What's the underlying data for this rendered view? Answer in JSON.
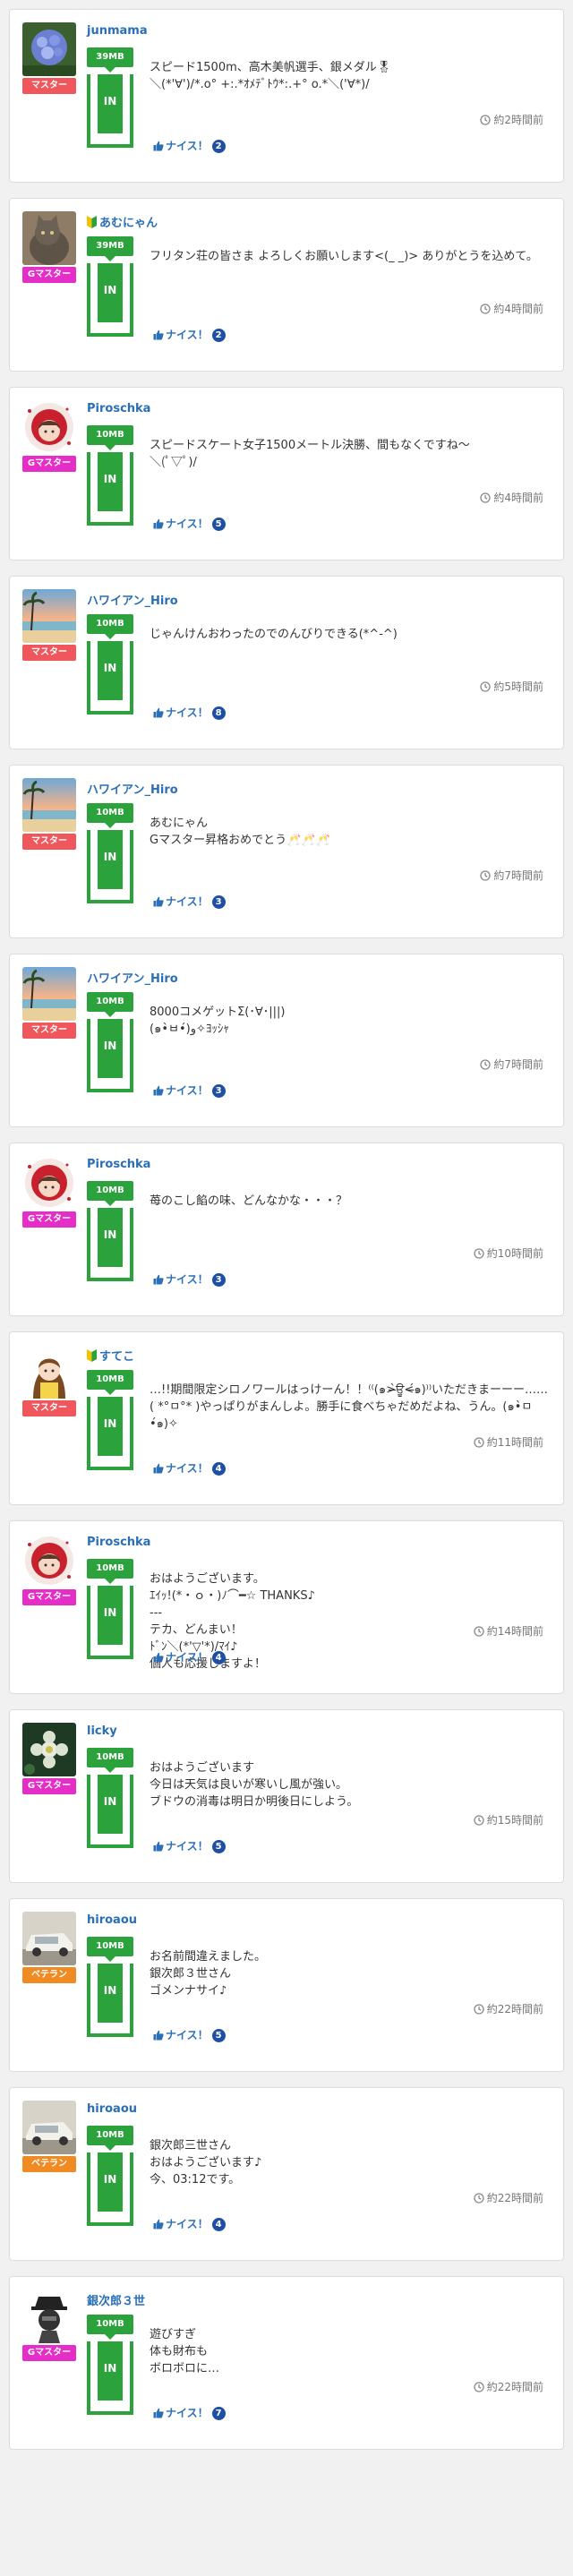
{
  "colors": {
    "rank_master": "#f0575c",
    "rank_g_master": "#e52dc7",
    "rank_veteran": "#f08b24",
    "data_green": "#2ba23b",
    "link_blue": "#2a6fb7"
  },
  "feed": [
    {
      "username": "junmama",
      "beginner_mark": false,
      "avatar": "hydrangea-photo",
      "rank": "マスター",
      "rank_type": "master",
      "data_amount": "39MB",
      "in_label": "IN",
      "message": "スピード1500m、高木美帆選手、銀メダル🎖\n＼(*'∀')/*.o° +:.*ｵﾒﾃﾞﾄｳ*:.+° o.*＼('∀*)/",
      "time": "約2時間前",
      "nice_label": "ナイス！",
      "nice_count": "2"
    },
    {
      "username": "あむにゃん",
      "beginner_mark": true,
      "avatar": "cat-photo",
      "rank": "Gマスター",
      "rank_type": "g_master",
      "data_amount": "39MB",
      "in_label": "IN",
      "message": "フリタン荘の皆さま よろしくお願いします<(_ _)> ありがとうを込めて。",
      "time": "約4時間前",
      "nice_label": "ナイス！",
      "nice_count": "2"
    },
    {
      "username": "Piroschka",
      "beginner_mark": false,
      "avatar": "red-hood-girl-illustration",
      "rank": "Gマスター",
      "rank_type": "g_master",
      "data_amount": "10MB",
      "in_label": "IN",
      "message": "スピードスケート女子1500メートル決勝、間もなくですね～\n＼(ﾟ▽ﾟ)/",
      "time": "約4時間前",
      "nice_label": "ナイス！",
      "nice_count": "5"
    },
    {
      "username": "ハワイアン_Hiro",
      "beginner_mark": false,
      "avatar": "sunset-beach-photo",
      "rank": "マスター",
      "rank_type": "master",
      "data_amount": "10MB",
      "in_label": "IN",
      "message": "じゃんけんおわったのでのんびりできる(*^-^)",
      "time": "約5時間前",
      "nice_label": "ナイス！",
      "nice_count": "8"
    },
    {
      "username": "ハワイアン_Hiro",
      "beginner_mark": false,
      "avatar": "sunset-beach-photo",
      "rank": "マスター",
      "rank_type": "master",
      "data_amount": "10MB",
      "in_label": "IN",
      "message": "あむにゃん\nGマスター昇格おめでとう🥂🥂🥂",
      "time": "約7時間前",
      "nice_label": "ナイス！",
      "nice_count": "3"
    },
    {
      "username": "ハワイアン_Hiro",
      "beginner_mark": false,
      "avatar": "sunset-beach-photo",
      "rank": "マスター",
      "rank_type": "master",
      "data_amount": "10MB",
      "in_label": "IN",
      "message": "8000コメゲットΣ(･∀･|||)\n(๑•̀ㅂ•́)و✧ﾖｯｼｬ",
      "time": "約7時間前",
      "nice_label": "ナイス！",
      "nice_count": "3"
    },
    {
      "username": "Piroschka",
      "beginner_mark": false,
      "avatar": "red-hood-girl-illustration",
      "rank": "Gマスター",
      "rank_type": "g_master",
      "data_amount": "10MB",
      "in_label": "IN",
      "message": "苺のこし餡の味、どんなかな・・・？",
      "time": "約10時間前",
      "nice_label": "ナイス！",
      "nice_count": "3"
    },
    {
      "username": "すてこ",
      "beginner_mark": true,
      "avatar": "girl-illustration",
      "rank": "マスター",
      "rank_type": "master",
      "data_amount": "10MB",
      "in_label": "IN",
      "message": "…!!期間限定シロノワールはっけーん！！⁽⁽(๑>̶̀ਊ<̶́๑)⁾⁾いただきまーーー……( *°ㅁ°* )やっぱりがまんしよ。勝手に食べちゃだめだよね、うん。(๑•̀ㅁ•́๑)✧",
      "time": "約11時間前",
      "nice_label": "ナイス！",
      "nice_count": "4"
    },
    {
      "username": "Piroschka",
      "beginner_mark": false,
      "avatar": "red-hood-girl-illustration",
      "rank": "Gマスター",
      "rank_type": "g_master",
      "data_amount": "10MB",
      "in_label": "IN",
      "message": "おはようございます。\nｴｲｯ!(*・ｏ・)ﾉ⌒━☆ THANKS♪\n---\nテカ、どんまい！\nﾄﾞﾝ＼(*'▽'*)/ﾏｲ♪\n個人も応援しますよ！",
      "time": "約14時間前",
      "nice_label": "ナイス！",
      "nice_count": "4"
    },
    {
      "username": "licky",
      "beginner_mark": false,
      "avatar": "dark-flower-photo",
      "rank": "Gマスター",
      "rank_type": "g_master",
      "data_amount": "10MB",
      "in_label": "IN",
      "message": "おはようございます\n今日は天気は良いが寒いし風が強い。\nブドウの消毒は明日か明後日にしよう。",
      "time": "約15時間前",
      "nice_label": "ナイス！",
      "nice_count": "5"
    },
    {
      "username": "hiroaou",
      "beginner_mark": false,
      "avatar": "car-photo",
      "rank": "ベテラン",
      "rank_type": "veteran",
      "data_amount": "10MB",
      "in_label": "IN",
      "message": "お名前間違えました。\n銀次郎３世さん\nゴメンナサイ♪",
      "time": "約22時間前",
      "nice_label": "ナイス！",
      "nice_count": "5"
    },
    {
      "username": "hiroaou",
      "beginner_mark": false,
      "avatar": "car-photo",
      "rank": "ベテラン",
      "rank_type": "veteran",
      "data_amount": "10MB",
      "in_label": "IN",
      "message": "銀次郎三世さん\nおはようございます♪\n今、03:12です。",
      "time": "約22時間前",
      "nice_label": "ナイス！",
      "nice_count": "4"
    },
    {
      "username": "銀次郎３世",
      "beginner_mark": false,
      "avatar": "hat-character-illustration",
      "rank": "Gマスター",
      "rank_type": "g_master",
      "data_amount": "10MB",
      "in_label": "IN",
      "message": "遊びすぎ\n体も財布も\nボロボロに…",
      "time": "約22時間前",
      "nice_label": "ナイス！",
      "nice_count": "7"
    }
  ]
}
